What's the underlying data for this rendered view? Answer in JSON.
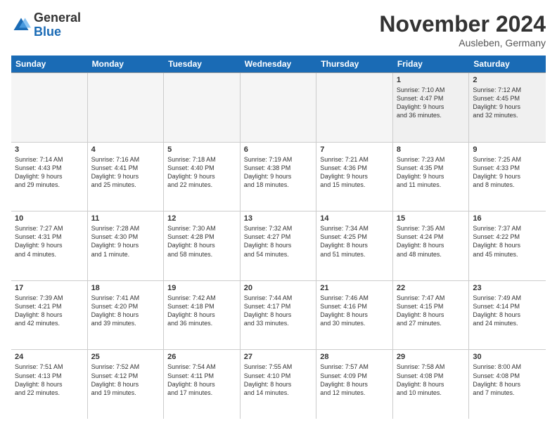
{
  "logo": {
    "general": "General",
    "blue": "Blue"
  },
  "header": {
    "month": "November 2024",
    "location": "Ausleben, Germany"
  },
  "weekdays": [
    "Sunday",
    "Monday",
    "Tuesday",
    "Wednesday",
    "Thursday",
    "Friday",
    "Saturday"
  ],
  "weeks": [
    [
      {
        "day": "",
        "info": "",
        "empty": true
      },
      {
        "day": "",
        "info": "",
        "empty": true
      },
      {
        "day": "",
        "info": "",
        "empty": true
      },
      {
        "day": "",
        "info": "",
        "empty": true
      },
      {
        "day": "",
        "info": "",
        "empty": true
      },
      {
        "day": "1",
        "info": "Sunrise: 7:10 AM\nSunset: 4:47 PM\nDaylight: 9 hours\nand 36 minutes.",
        "empty": false
      },
      {
        "day": "2",
        "info": "Sunrise: 7:12 AM\nSunset: 4:45 PM\nDaylight: 9 hours\nand 32 minutes.",
        "empty": false
      }
    ],
    [
      {
        "day": "3",
        "info": "Sunrise: 7:14 AM\nSunset: 4:43 PM\nDaylight: 9 hours\nand 29 minutes.",
        "empty": false
      },
      {
        "day": "4",
        "info": "Sunrise: 7:16 AM\nSunset: 4:41 PM\nDaylight: 9 hours\nand 25 minutes.",
        "empty": false
      },
      {
        "day": "5",
        "info": "Sunrise: 7:18 AM\nSunset: 4:40 PM\nDaylight: 9 hours\nand 22 minutes.",
        "empty": false
      },
      {
        "day": "6",
        "info": "Sunrise: 7:19 AM\nSunset: 4:38 PM\nDaylight: 9 hours\nand 18 minutes.",
        "empty": false
      },
      {
        "day": "7",
        "info": "Sunrise: 7:21 AM\nSunset: 4:36 PM\nDaylight: 9 hours\nand 15 minutes.",
        "empty": false
      },
      {
        "day": "8",
        "info": "Sunrise: 7:23 AM\nSunset: 4:35 PM\nDaylight: 9 hours\nand 11 minutes.",
        "empty": false
      },
      {
        "day": "9",
        "info": "Sunrise: 7:25 AM\nSunset: 4:33 PM\nDaylight: 9 hours\nand 8 minutes.",
        "empty": false
      }
    ],
    [
      {
        "day": "10",
        "info": "Sunrise: 7:27 AM\nSunset: 4:31 PM\nDaylight: 9 hours\nand 4 minutes.",
        "empty": false
      },
      {
        "day": "11",
        "info": "Sunrise: 7:28 AM\nSunset: 4:30 PM\nDaylight: 9 hours\nand 1 minute.",
        "empty": false
      },
      {
        "day": "12",
        "info": "Sunrise: 7:30 AM\nSunset: 4:28 PM\nDaylight: 8 hours\nand 58 minutes.",
        "empty": false
      },
      {
        "day": "13",
        "info": "Sunrise: 7:32 AM\nSunset: 4:27 PM\nDaylight: 8 hours\nand 54 minutes.",
        "empty": false
      },
      {
        "day": "14",
        "info": "Sunrise: 7:34 AM\nSunset: 4:25 PM\nDaylight: 8 hours\nand 51 minutes.",
        "empty": false
      },
      {
        "day": "15",
        "info": "Sunrise: 7:35 AM\nSunset: 4:24 PM\nDaylight: 8 hours\nand 48 minutes.",
        "empty": false
      },
      {
        "day": "16",
        "info": "Sunrise: 7:37 AM\nSunset: 4:22 PM\nDaylight: 8 hours\nand 45 minutes.",
        "empty": false
      }
    ],
    [
      {
        "day": "17",
        "info": "Sunrise: 7:39 AM\nSunset: 4:21 PM\nDaylight: 8 hours\nand 42 minutes.",
        "empty": false
      },
      {
        "day": "18",
        "info": "Sunrise: 7:41 AM\nSunset: 4:20 PM\nDaylight: 8 hours\nand 39 minutes.",
        "empty": false
      },
      {
        "day": "19",
        "info": "Sunrise: 7:42 AM\nSunset: 4:18 PM\nDaylight: 8 hours\nand 36 minutes.",
        "empty": false
      },
      {
        "day": "20",
        "info": "Sunrise: 7:44 AM\nSunset: 4:17 PM\nDaylight: 8 hours\nand 33 minutes.",
        "empty": false
      },
      {
        "day": "21",
        "info": "Sunrise: 7:46 AM\nSunset: 4:16 PM\nDaylight: 8 hours\nand 30 minutes.",
        "empty": false
      },
      {
        "day": "22",
        "info": "Sunrise: 7:47 AM\nSunset: 4:15 PM\nDaylight: 8 hours\nand 27 minutes.",
        "empty": false
      },
      {
        "day": "23",
        "info": "Sunrise: 7:49 AM\nSunset: 4:14 PM\nDaylight: 8 hours\nand 24 minutes.",
        "empty": false
      }
    ],
    [
      {
        "day": "24",
        "info": "Sunrise: 7:51 AM\nSunset: 4:13 PM\nDaylight: 8 hours\nand 22 minutes.",
        "empty": false
      },
      {
        "day": "25",
        "info": "Sunrise: 7:52 AM\nSunset: 4:12 PM\nDaylight: 8 hours\nand 19 minutes.",
        "empty": false
      },
      {
        "day": "26",
        "info": "Sunrise: 7:54 AM\nSunset: 4:11 PM\nDaylight: 8 hours\nand 17 minutes.",
        "empty": false
      },
      {
        "day": "27",
        "info": "Sunrise: 7:55 AM\nSunset: 4:10 PM\nDaylight: 8 hours\nand 14 minutes.",
        "empty": false
      },
      {
        "day": "28",
        "info": "Sunrise: 7:57 AM\nSunset: 4:09 PM\nDaylight: 8 hours\nand 12 minutes.",
        "empty": false
      },
      {
        "day": "29",
        "info": "Sunrise: 7:58 AM\nSunset: 4:08 PM\nDaylight: 8 hours\nand 10 minutes.",
        "empty": false
      },
      {
        "day": "30",
        "info": "Sunrise: 8:00 AM\nSunset: 4:08 PM\nDaylight: 8 hours\nand 7 minutes.",
        "empty": false
      }
    ]
  ]
}
